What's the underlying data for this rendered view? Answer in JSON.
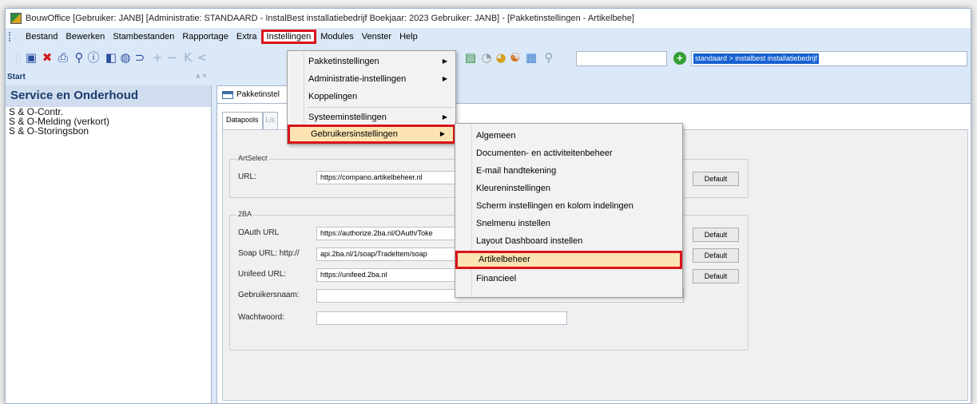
{
  "window": {
    "title": "BouwOffice [Gebruiker: JANB] [Administratie: STANDAARD - InstalBest installatiebedrijf  Boekjaar: 2023  Gebruiker: JANB] - [Pakketinstellingen - Artikelbehe]"
  },
  "menubar": {
    "items": [
      "Bestand",
      "Bewerken",
      "Stambestanden",
      "Rapportage",
      "Extra",
      "Instellingen",
      "Modules",
      "Venster",
      "Help"
    ]
  },
  "toolbar": {
    "path_text": "standaard > instalbest installatiebedrijf",
    "plus_label": "+"
  },
  "left_panel": {
    "header": "Start",
    "header_buttons": "ᴀ ×",
    "title": "Service en Onderhoud",
    "items": [
      "S & O-Contr.",
      "S & O-Melding (verkort)",
      "S & O-Storingsbon"
    ]
  },
  "doc_tab": {
    "label": "Pakketinstel"
  },
  "inner_tabs": [
    "Datapools",
    "Lis"
  ],
  "artselect": {
    "title": "ArtSelect",
    "url_label": "URL:",
    "url_value": "https://compano.artikelbeheer.nl",
    "default": "Default"
  },
  "twoba": {
    "title": "2BA",
    "oauth_label": "OAuth URL",
    "oauth_value": "https://authorize.2ba.nl/OAuth/Toke",
    "soap_label": "Soap URL: http://",
    "soap_value": "api.2ba.nl/1/soap/TradeItem/soap",
    "unifeed_label": "Unifeed URL:",
    "unifeed_value": "https://unifeed.2ba.nl",
    "user_label": "Gebruikersnaam:",
    "password_label": "Wachtwoord:",
    "default": "Default"
  },
  "instellingen_menu": {
    "items": [
      "Pakketinstellingen",
      "Administratie-instellingen",
      "Koppelingen",
      "Systeeminstellingen",
      "Gebruikersinstellingen"
    ]
  },
  "gebruikers_menu": {
    "items": [
      "Algemeen",
      "Documenten- en activiteitenbeheer",
      "E-mail handtekening",
      "Kleureninstellingen",
      "Scherm instellingen en kolom indelingen",
      "Snelmenu instellen",
      "Layout Dashboard instellen",
      "Artikelbeheer",
      "Financieel"
    ]
  },
  "colors": {
    "highlight_border": "#d9141b",
    "hover_fill": "#fce4b2",
    "window_bg": "#dbe8f7"
  }
}
